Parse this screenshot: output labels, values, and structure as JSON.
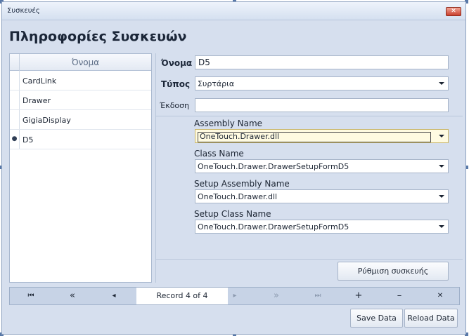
{
  "window": {
    "title": "Συσκευές",
    "close_glyph": "✕"
  },
  "page_title": "Πληροφορίες Συσκευών",
  "grid": {
    "column_header": "Όνομα",
    "rows": [
      {
        "name": "CardLink",
        "indicator": ""
      },
      {
        "name": "Drawer",
        "indicator": ""
      },
      {
        "name": "GigiaDisplay",
        "indicator": ""
      },
      {
        "name": "D5",
        "indicator": "●"
      }
    ]
  },
  "form": {
    "name_label": "Όνομα",
    "name_value": "D5",
    "type_label": "Τύπος",
    "type_value": "Συρτάρια",
    "version_label": "Έκδοση",
    "version_value": "",
    "assembly_label": "Assembly Name",
    "assembly_value": "OneTouch.Drawer.dll",
    "class_label": "Class Name",
    "class_value": "OneTouch.Drawer.DrawerSetupFormD5",
    "setup_assembly_label": "Setup Assembly Name",
    "setup_assembly_value": "OneTouch.Drawer.dll",
    "setup_class_label": "Setup Class Name",
    "setup_class_value": "OneTouch.Drawer.DrawerSetupFormD5",
    "device_setup_button": "Ρύθμιση συσκευής"
  },
  "navigator": {
    "first": "⏮",
    "prev_page": "«",
    "prev": "◂",
    "record_text": "Record 4 of 4",
    "next": "▸",
    "next_page": "»",
    "last": "⏭",
    "add": "+",
    "remove": "–",
    "cancel": "✕"
  },
  "actions": {
    "save_label": "Save Data",
    "reload_label": "Reload Data"
  }
}
